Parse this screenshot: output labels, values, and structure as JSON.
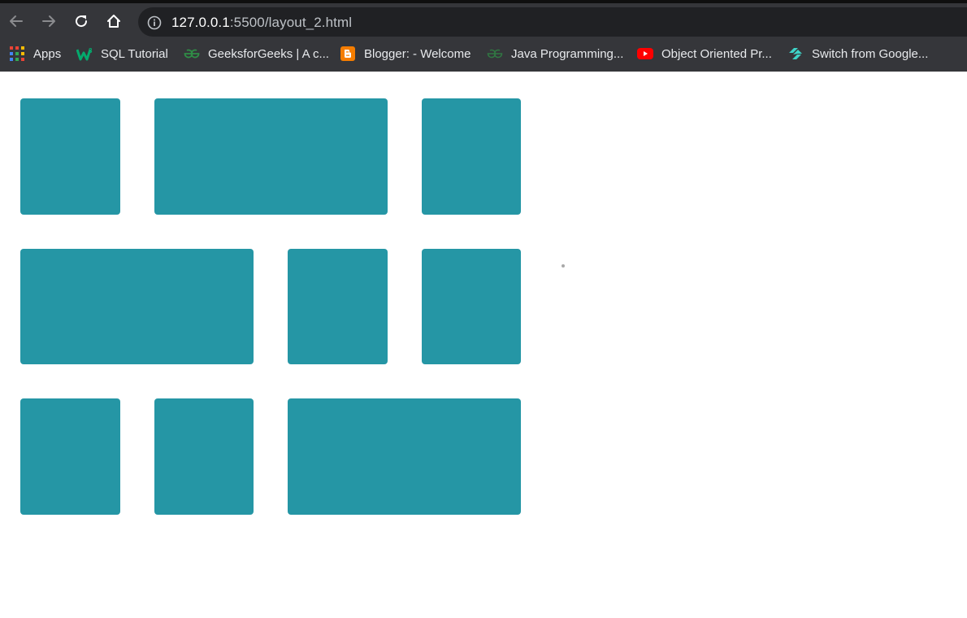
{
  "browser": {
    "address_host": "127.0.0.1",
    "address_rest": ":5500/layout_2.html"
  },
  "bookmarks": [
    {
      "label": "Apps",
      "icon": "apps-grid-icon"
    },
    {
      "label": "SQL Tutorial",
      "icon": "w3schools-icon"
    },
    {
      "label": "GeeksforGeeks | A c...",
      "icon": "geeksforgeeks-icon"
    },
    {
      "label": "Blogger: - Welcome",
      "icon": "blogger-icon"
    },
    {
      "label": "Java Programming...",
      "icon": "geeksforgeeks-icon"
    },
    {
      "label": "Object Oriented Pr...",
      "icon": "youtube-icon"
    },
    {
      "label": "Switch from Google...",
      "icon": "switch-icon"
    }
  ],
  "layout_grid": {
    "tile_color": "#2596a5",
    "rows": [
      [
        "small",
        "wide",
        "small"
      ],
      [
        "wide",
        "small",
        "small"
      ],
      [
        "small",
        "small",
        "wide"
      ]
    ]
  }
}
